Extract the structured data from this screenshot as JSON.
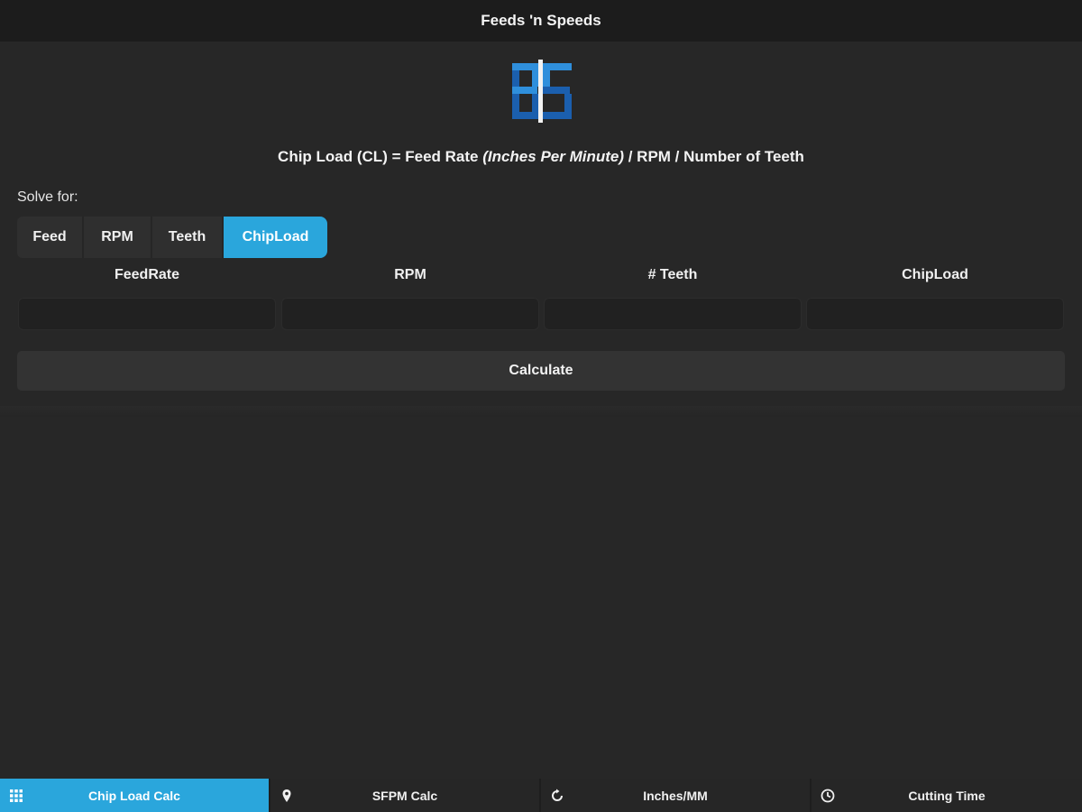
{
  "header": {
    "title": "Feeds 'n Speeds"
  },
  "formula": {
    "part1": "Chip Load (CL) = Feed Rate ",
    "italic": "(Inches Per Minute)",
    "part2": " / RPM / Number of Teeth"
  },
  "solve": {
    "label": "Solve for:",
    "options": [
      "Feed",
      "RPM",
      "Teeth",
      "ChipLoad"
    ],
    "selected": "ChipLoad"
  },
  "columns": {
    "headers": [
      "FeedRate",
      "RPM",
      "# Teeth",
      "ChipLoad"
    ],
    "values": [
      "",
      "",
      "",
      ""
    ]
  },
  "calculate_label": "Calculate",
  "tabs": [
    {
      "label": "Chip Load Calc",
      "icon": "grid-icon",
      "active": true
    },
    {
      "label": "SFPM Calc",
      "icon": "map-pin-icon",
      "active": false
    },
    {
      "label": "Inches/MM",
      "icon": "refresh-icon",
      "active": false
    },
    {
      "label": "Cutting Time",
      "icon": "clock-icon",
      "active": false
    }
  ],
  "colors": {
    "accent": "#2aa6dc",
    "logo_dark_blue": "#1b5fae",
    "logo_light_blue": "#2f8fdc",
    "background": "#272727",
    "header": "#1c1c1c"
  }
}
